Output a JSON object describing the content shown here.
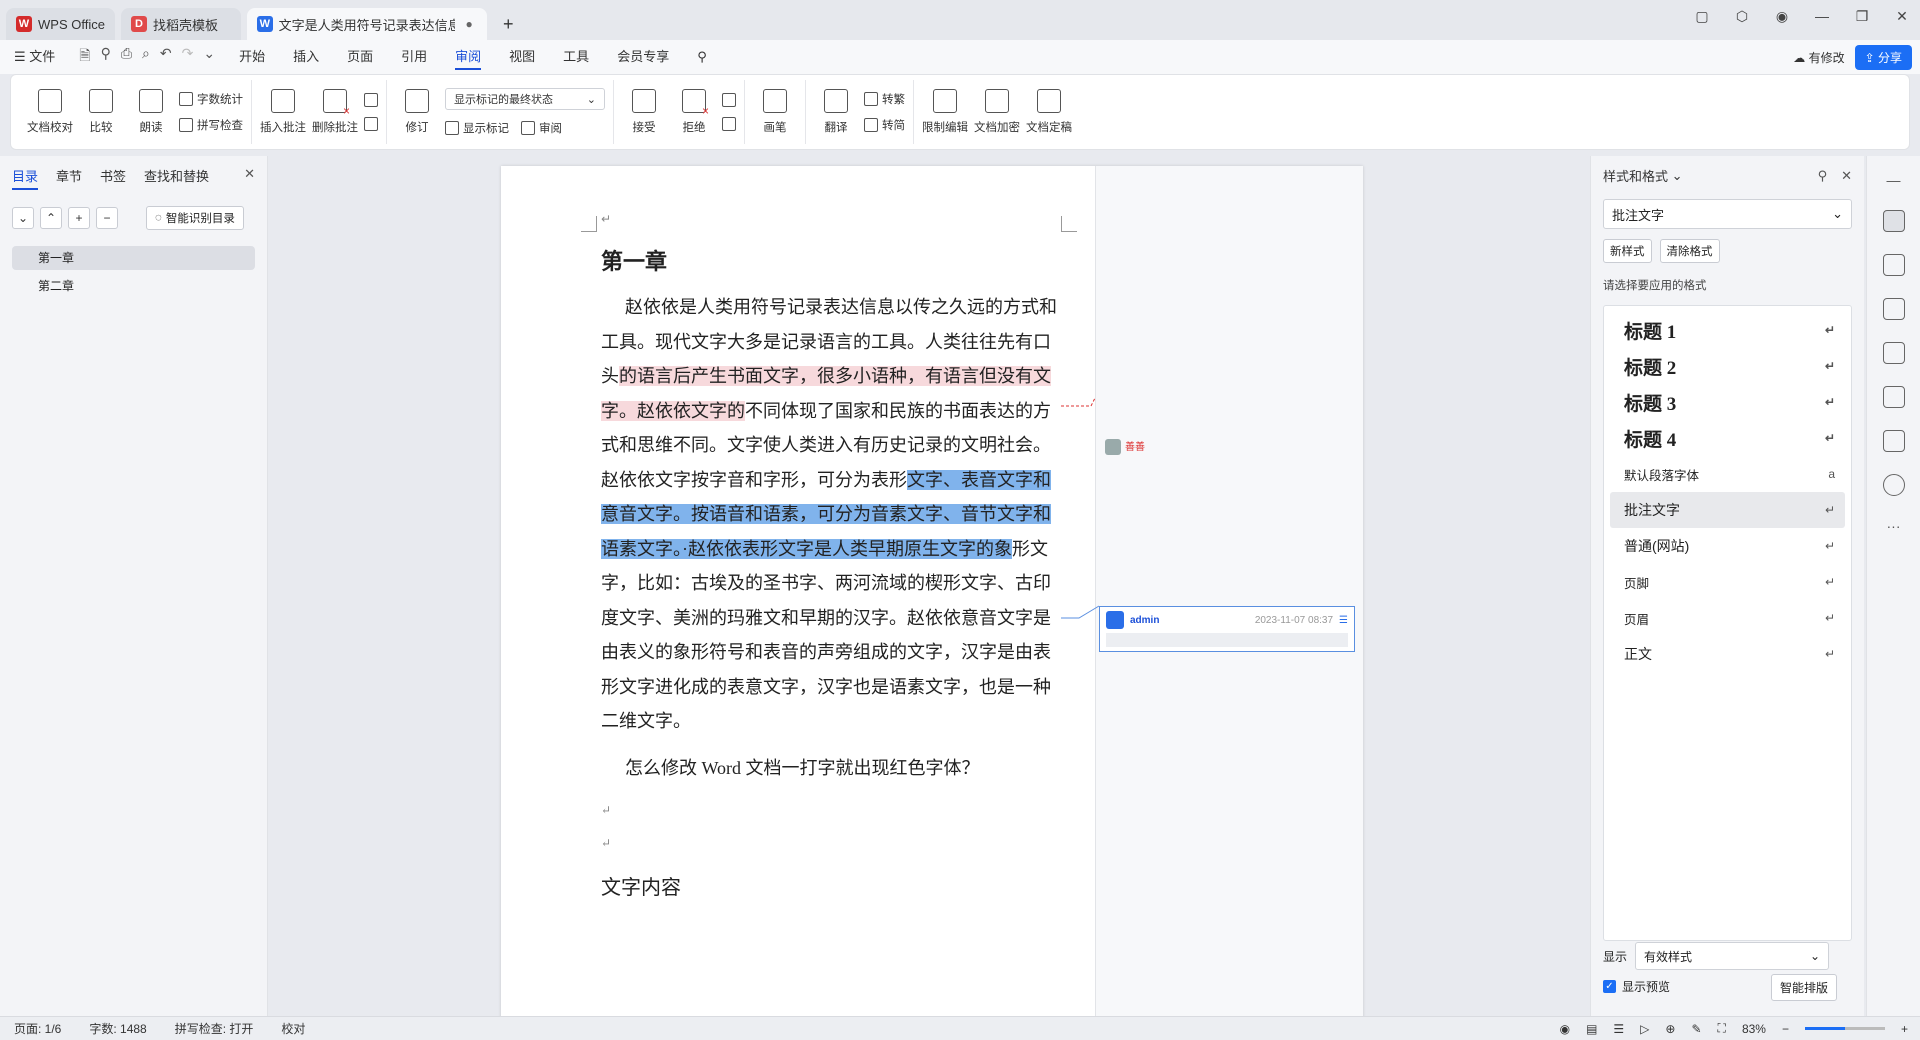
{
  "titlebar": {
    "tabs": [
      {
        "label": "WPS Office",
        "state": "inactive"
      },
      {
        "label": "找稻壳模板",
        "state": "inactive"
      },
      {
        "label": "文字是人类用符号记录表达信息以",
        "state": "active"
      }
    ],
    "new_tab": "+"
  },
  "menubar": {
    "file": "文件",
    "items": [
      "开始",
      "插入",
      "页面",
      "引用",
      "审阅",
      "视图",
      "工具",
      "会员专享"
    ],
    "active": "审阅",
    "has_modified": "有修改",
    "share": "分享"
  },
  "ribbon": {
    "doc_check": "文档校对",
    "compare": "比较",
    "read_aloud": "朗读",
    "word_count": "字数统计",
    "spell_check": "拼写检查",
    "insert_comment": "插入批注",
    "delete_comment": "删除批注",
    "revise": "修订",
    "mark_mode": "显示标记的最终状态",
    "show_marks": "显示标记",
    "review_pane": "审阅",
    "accept": "接受",
    "reject": "拒绝",
    "pen": "画笔",
    "translate": "翻译",
    "to_traditional": "转繁",
    "to_simplified": "转简",
    "restrict_edit": "限制编辑",
    "doc_encrypt": "文档加密",
    "doc_finalize": "文档定稿"
  },
  "leftpane": {
    "tabs": [
      "目录",
      "章节",
      "书签",
      "查找和替换"
    ],
    "active_tab": "目录",
    "smart_toc": "智能识别目录",
    "toc": [
      "第一章",
      "第二章"
    ]
  },
  "document": {
    "heading1": "第一章",
    "para1_a": "赵依依是人类用符号记录表达信息以传之久远的方式和工具。现代文字大多是记录语言的工具。人类往往先有口头",
    "para1_red": "的语言后产生书面文字，很多小语种，有语言但没有文字。赵依依文字的",
    "para1_b": "不同体现了国家和民族的书面表达的方式和思维不同。文字使人类进入有历史记录的文明社会。赵依依文字按字音和字形，可分为表形",
    "para1_blue": "文字、表音文字和意音文字。按语音和语素，可分为音素文字、音节文字和语素文字。·赵依依表形文字是人类早期原生文字的象",
    "para1_c": "形文字，比如：古埃及的圣书字、两河流域的楔形文字、古印度文字、美洲的玛雅文和早期的汉字。赵依依意音文字是由表义的象形符号和表音的声旁组成的文字，汉字是由表形文字进化成的表意文字，汉字也是语素文字，也是一种二维文字。",
    "para2": "怎么修改 Word 文档一打字就出现红色字体？",
    "heading2": "文字内容",
    "revision_user": "善善",
    "comment_user": "admin",
    "comment_time": "2023-11-07 08:37"
  },
  "rightpane": {
    "title": "样式和格式",
    "current_style": "批注文字",
    "new_style": "新样式",
    "clear_format": "清除格式",
    "hint": "请选择要应用的格式",
    "styles": [
      {
        "name": "标题  1",
        "kind": "h"
      },
      {
        "name": "标题  2",
        "kind": "h"
      },
      {
        "name": "标题  3",
        "kind": "h"
      },
      {
        "name": "标题  4",
        "kind": "h"
      },
      {
        "name": "默认段落字体",
        "kind": "s"
      },
      {
        "name": "批注文字",
        "kind": "n"
      },
      {
        "name": "普通(网站)",
        "kind": "n"
      },
      {
        "name": "页脚",
        "kind": "s"
      },
      {
        "name": "页眉",
        "kind": "s"
      },
      {
        "name": "正文",
        "kind": "n"
      }
    ],
    "show_label": "显示",
    "show_value": "有效样式",
    "preview": "显示预览",
    "smart_layout": "智能排版"
  },
  "statusbar": {
    "page": "页面: 1/6",
    "words": "字数: 1488",
    "spell": "拼写检查: 打开",
    "proof": "校对",
    "zoom": "83%",
    "zoom_fraction": 0.5
  },
  "colors": {
    "accent": "#1b4fd8",
    "revision_highlight": "#f7d9dc",
    "selection": "#80b3ec"
  }
}
